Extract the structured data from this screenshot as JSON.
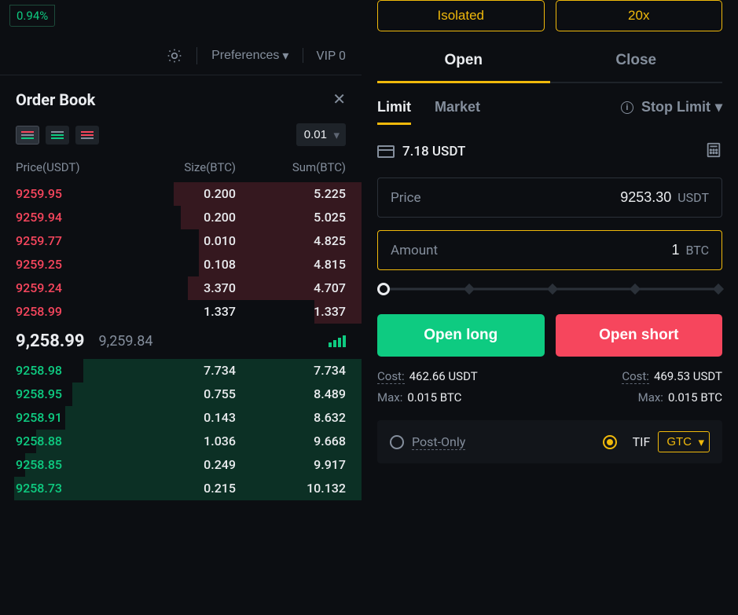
{
  "topbar": {
    "change_pct": "0.94%",
    "preferences_label": "Preferences",
    "vip_label": "VIP 0"
  },
  "orderbook": {
    "title": "Order Book",
    "tick_size": "0.01",
    "col_price": "Price(USDT)",
    "col_size": "Size(BTC)",
    "col_sum": "Sum(BTC)",
    "asks": [
      {
        "price": "9259.95",
        "size": "0.200",
        "sum": "5.225",
        "depth": 52
      },
      {
        "price": "9259.94",
        "size": "0.200",
        "sum": "5.025",
        "depth": 50
      },
      {
        "price": "9259.77",
        "size": "0.010",
        "sum": "4.825",
        "depth": 45
      },
      {
        "price": "9259.25",
        "size": "0.108",
        "sum": "4.815",
        "depth": 45
      },
      {
        "price": "9259.24",
        "size": "3.370",
        "sum": "4.707",
        "depth": 48
      },
      {
        "price": "9258.99",
        "size": "1.337",
        "sum": "1.337",
        "depth": 13
      }
    ],
    "mid_price": "9,258.99",
    "mark_price": "9,259.84",
    "bids": [
      {
        "price": "9258.98",
        "size": "7.734",
        "sum": "7.734",
        "depth": 77
      },
      {
        "price": "9258.95",
        "size": "0.755",
        "sum": "8.489",
        "depth": 80
      },
      {
        "price": "9258.91",
        "size": "0.143",
        "sum": "8.632",
        "depth": 82
      },
      {
        "price": "9258.88",
        "size": "1.036",
        "sum": "9.668",
        "depth": 90
      },
      {
        "price": "9258.85",
        "size": "0.249",
        "sum": "9.917",
        "depth": 93
      },
      {
        "price": "9258.73",
        "size": "0.215",
        "sum": "10.132",
        "depth": 96
      }
    ]
  },
  "trade": {
    "margin_mode": "Isolated",
    "leverage": "20x",
    "tab_open": "Open",
    "tab_close": "Close",
    "type_limit": "Limit",
    "type_market": "Market",
    "type_stop": "Stop Limit",
    "balance": "7.18 USDT",
    "price_label": "Price",
    "price_value": "9253.30",
    "price_unit": "USDT",
    "amount_label": "Amount",
    "amount_value": "1",
    "amount_unit": "BTC",
    "open_long": "Open long",
    "open_short": "Open short",
    "cost_long_label": "Cost:",
    "cost_long_val": "462.66 USDT",
    "cost_short_label": "Cost:",
    "cost_short_val": "469.53 USDT",
    "max_long_label": "Max:",
    "max_long_val": "0.015 BTC",
    "max_short_label": "Max:",
    "max_short_val": "0.015 BTC",
    "post_only": "Post-Only",
    "tif_label": "TIF",
    "tif_value": "GTC"
  }
}
